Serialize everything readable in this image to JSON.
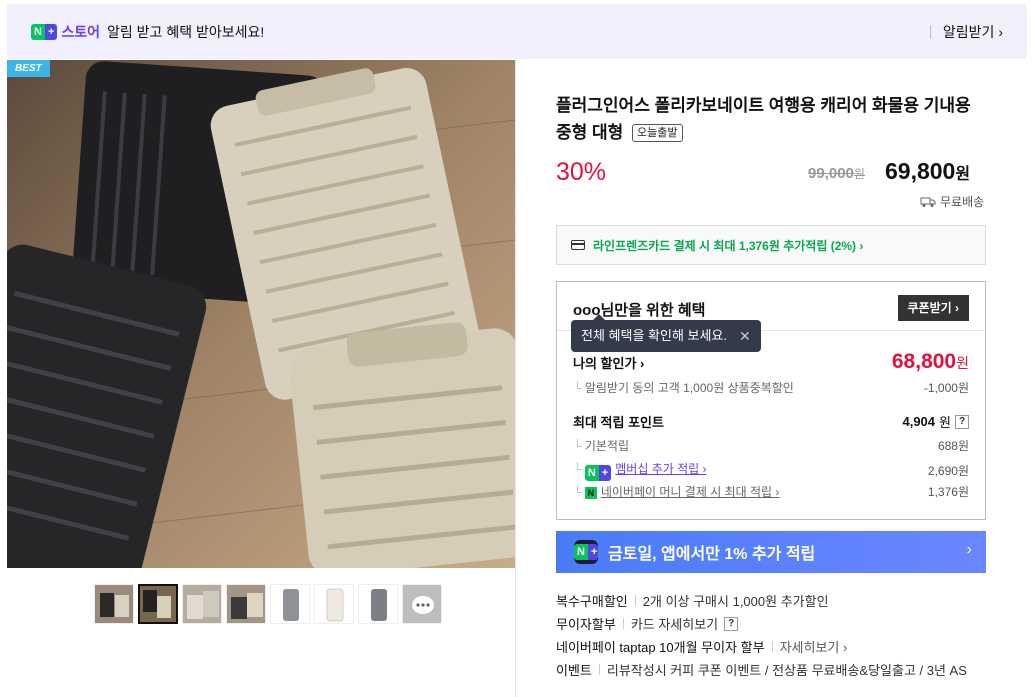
{
  "banner": {
    "store_label": "스토어",
    "message": "알림 받고 혜택 받아보세요!",
    "subscribe_label": "알림받기 ›"
  },
  "badge": {
    "best": "BEST"
  },
  "product": {
    "title": "플러그인어스 폴리카보네이트 여행용 캐리어 화물용 기내용 중형 대형",
    "today_ship": "오늘출발",
    "discount_rate": "30%",
    "original_price": "99,000",
    "price": "69,800",
    "won": "원",
    "shipping": "무료배송"
  },
  "card_promo": "라인프렌즈카드 결제 시 최대 1,376원 추가적립 (2%) ›",
  "benefit": {
    "title": "ooo님만을 위한 혜택",
    "coupon_button": "쿠폰받기 ›",
    "tooltip": "전체 혜택을 확인해 보세요.",
    "my_discount_label": "나의 할인가 ›",
    "my_discount_price": "68,800",
    "won": "원",
    "alarm_discount_label": "알림받기 동의 고객 1,000원 상품중복할인",
    "alarm_discount_value": "-1,000원",
    "max_points_label": "최대 적립 포인트",
    "max_points_value": "4,904",
    "basic_points_label": "기본적립",
    "basic_points_value": "688원",
    "membership_label": "멤버십 추가 적립 ›",
    "membership_value": "2,690원",
    "npay_label": "네이버페이 머니 결제 시 최대 적립 ›",
    "npay_value": "1,376원"
  },
  "promo_banner": {
    "text": "금토일, 앱에서만 1% 추가 적립",
    "arrow": "›"
  },
  "info": [
    {
      "key": "복수구매할인",
      "detail": "2개 이상 구매시 1,000원 추가할인",
      "more": ""
    },
    {
      "key": "무이자할부",
      "detail": "카드 자세히보기",
      "more": ""
    },
    {
      "key": "네이버페이 taptap 10개월 무이자 할부",
      "detail": "자세히보기 ›",
      "more": ""
    },
    {
      "key": "이벤트",
      "detail": "리뷰작성시 커피 쿠폰 이벤트 / 전상품 무료배송&당일출고 / 3년 AS",
      "more": ""
    }
  ],
  "colors": {
    "accent_red": "#e0133d",
    "naver_green": "#09c35c",
    "plus_purple": "#6a3df0",
    "promo_blue": "#4a7bf7"
  }
}
